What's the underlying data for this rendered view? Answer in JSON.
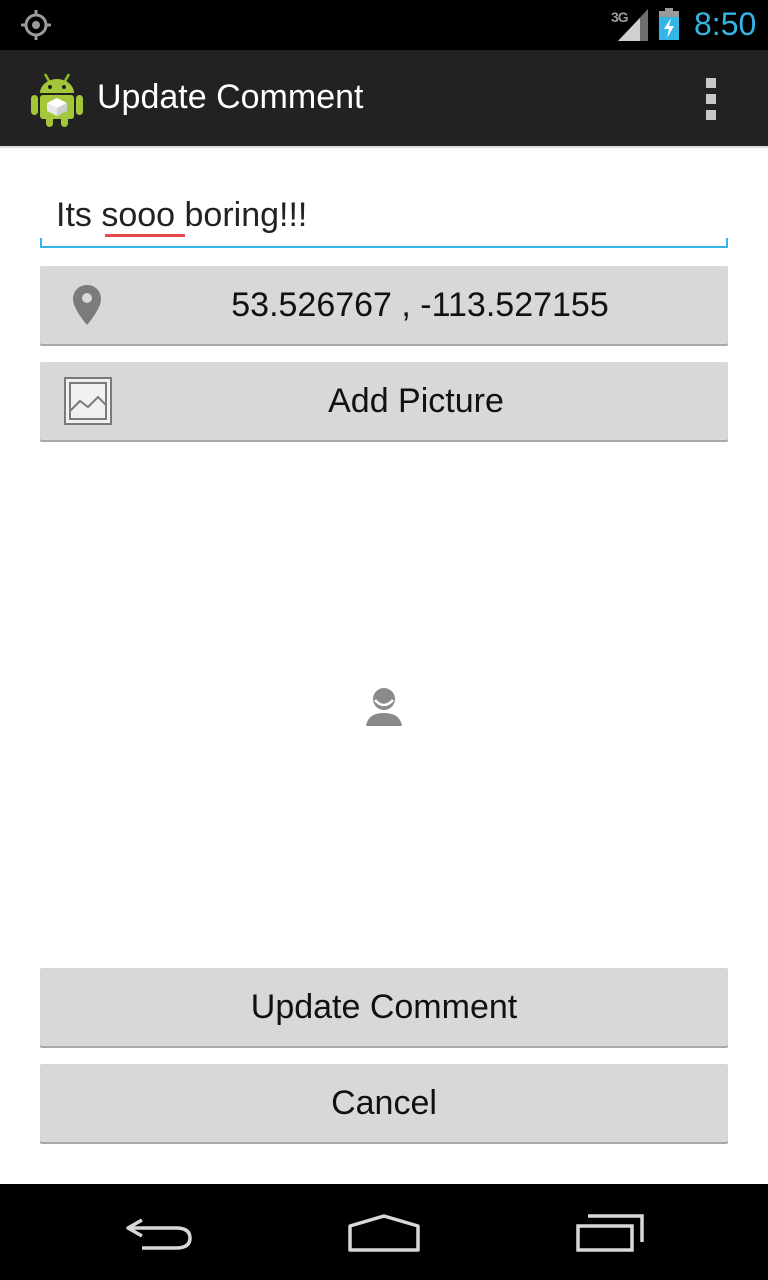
{
  "status_bar": {
    "icons": [
      "gps-icon",
      "3g-icon",
      "signal-icon",
      "battery-charging-icon"
    ],
    "network_type": "3G",
    "time": "8:50",
    "time_color": "#33b5e5"
  },
  "action_bar": {
    "title": "Update Comment",
    "app_icon": "android-app-icon",
    "menu_icon": "overflow-menu-icon"
  },
  "comment": {
    "value": "Its sooo boring!!!",
    "misspelled_word": "sooo"
  },
  "location_button": {
    "icon": "location-pin-icon",
    "label": "53.526767 , -113.527155"
  },
  "picture_button": {
    "icon": "picture-icon",
    "label": "Add Picture"
  },
  "image_preview": {
    "icon": "user-placeholder-icon"
  },
  "actions": {
    "update_label": "Update Comment",
    "cancel_label": "Cancel"
  },
  "nav_bar": {
    "icons": [
      "back-icon",
      "home-icon",
      "recent-apps-icon"
    ]
  },
  "colors": {
    "accent": "#33b5e5",
    "action_bar_bg": "#222222",
    "button_bg": "#d8d8d8",
    "spell_underline": "#e5484d"
  }
}
